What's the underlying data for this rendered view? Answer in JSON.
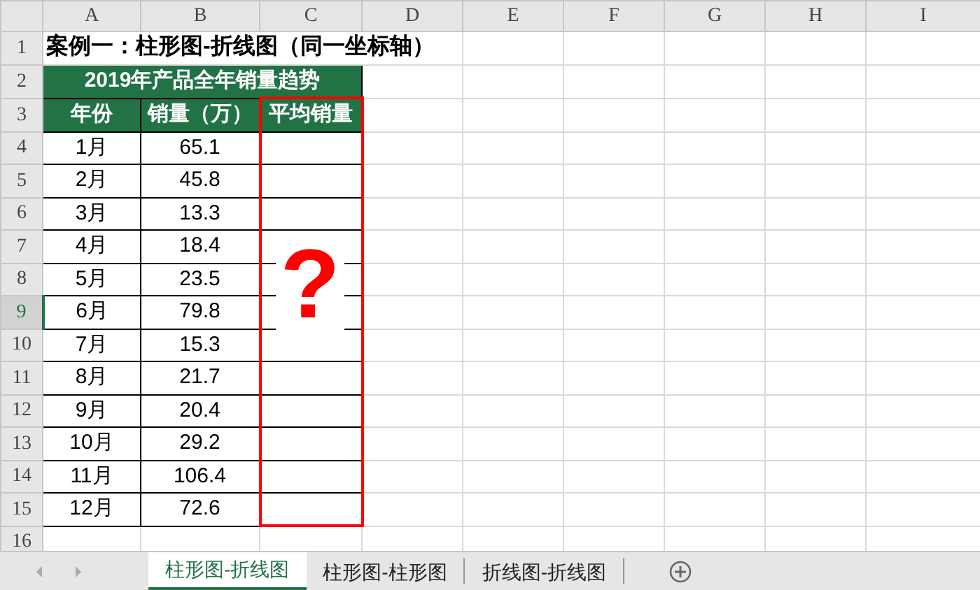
{
  "column_headers": [
    {
      "label": "A",
      "selected": false
    },
    {
      "label": "B",
      "selected": false
    },
    {
      "label": "C",
      "selected": false
    },
    {
      "label": "D",
      "selected": false
    },
    {
      "label": "E",
      "selected": false
    },
    {
      "label": "F",
      "selected": false
    },
    {
      "label": "G",
      "selected": false
    },
    {
      "label": "H",
      "selected": false
    },
    {
      "label": "I",
      "selected": false
    }
  ],
  "row_headers": [
    {
      "label": "1",
      "selected": false
    },
    {
      "label": "2",
      "selected": false
    },
    {
      "label": "3",
      "selected": false
    },
    {
      "label": "4",
      "selected": false
    },
    {
      "label": "5",
      "selected": false
    },
    {
      "label": "6",
      "selected": false
    },
    {
      "label": "7",
      "selected": false
    },
    {
      "label": "8",
      "selected": false
    },
    {
      "label": "9",
      "selected": true
    },
    {
      "label": "10",
      "selected": false
    },
    {
      "label": "11",
      "selected": false
    },
    {
      "label": "12",
      "selected": false
    },
    {
      "label": "13",
      "selected": false
    },
    {
      "label": "14",
      "selected": false
    },
    {
      "label": "15",
      "selected": false
    },
    {
      "label": "16",
      "selected": false
    }
  ],
  "title": "案例一：柱形图-折线图（同一坐标轴）",
  "table": {
    "title": "2019年产品全年销量趋势",
    "columns": [
      {
        "label": "年份",
        "highlighted": false
      },
      {
        "label": "销量（万）",
        "highlighted": false
      },
      {
        "label": "平均销量",
        "highlighted": true
      }
    ],
    "rows": [
      [
        "1月",
        "65.1"
      ],
      [
        "2月",
        "45.8"
      ],
      [
        "3月",
        "13.3"
      ],
      [
        "4月",
        "18.4"
      ],
      [
        "5月",
        "23.5"
      ],
      [
        "6月",
        "79.8"
      ],
      [
        "7月",
        "15.3"
      ],
      [
        "8月",
        "21.7"
      ],
      [
        "9月",
        "20.4"
      ],
      [
        "10月",
        "29.2"
      ],
      [
        "11月",
        "106.4"
      ],
      [
        "12月",
        "72.6"
      ]
    ],
    "mark": "?"
  },
  "sheet_tabs": [
    {
      "label": "柱形图-折线图",
      "selected": true
    },
    {
      "label": "柱形图-柱形图",
      "selected": false
    },
    {
      "label": "折线图-折线图",
      "selected": false
    }
  ]
}
